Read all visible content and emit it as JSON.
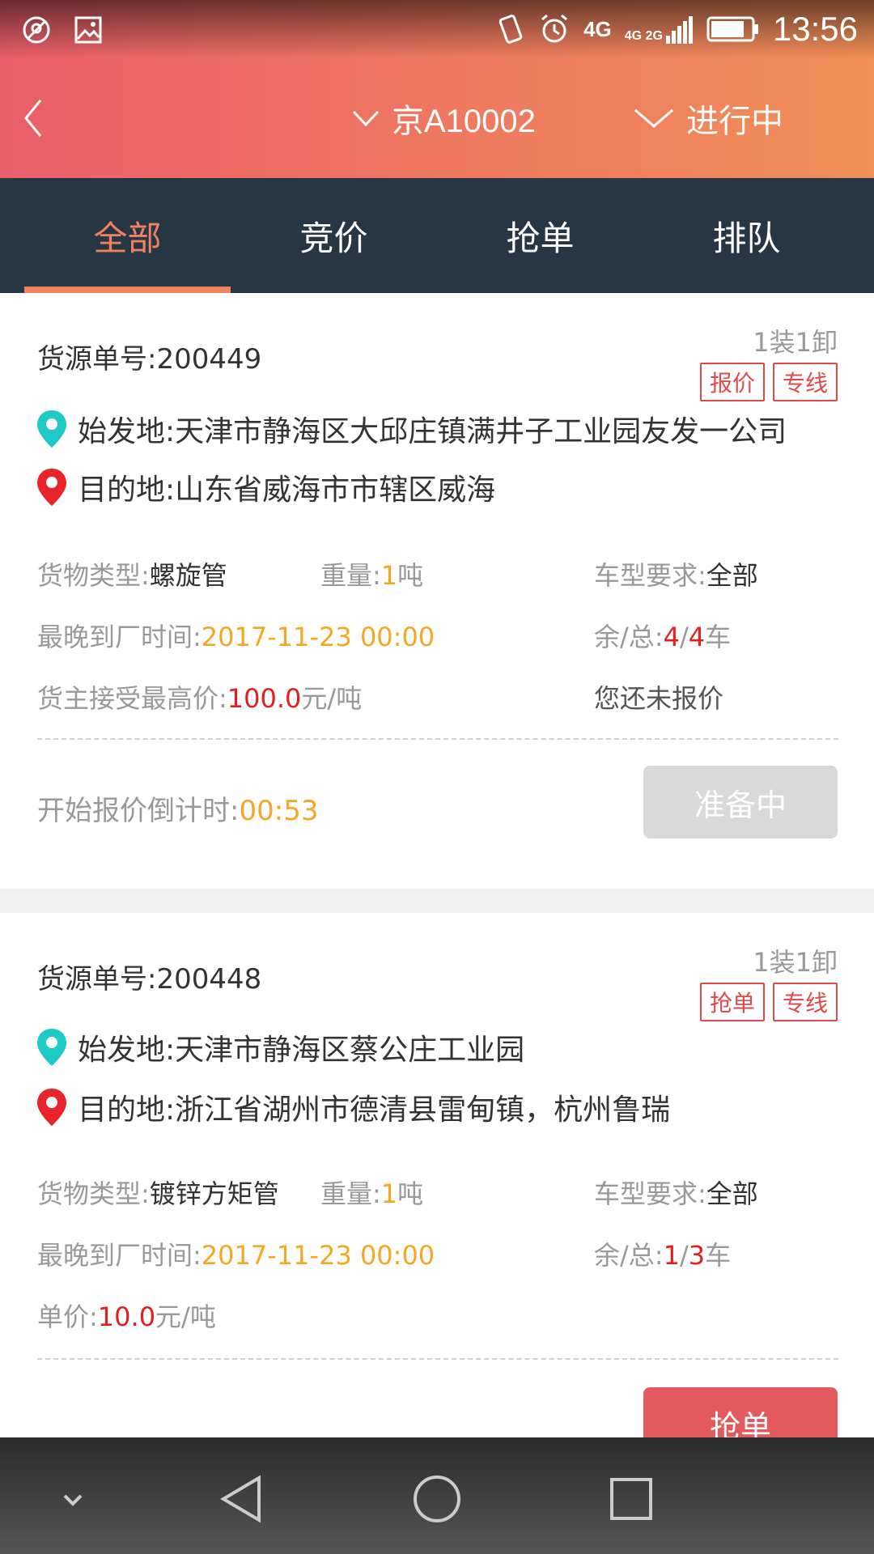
{
  "status_bar": {
    "time": "13:56",
    "network": "4G",
    "network_secondary": "4G 2G"
  },
  "app_bar": {
    "plate_selector": "京A10002",
    "status_selector": "进行中"
  },
  "tabs": [
    {
      "label": "全部",
      "active": true
    },
    {
      "label": "竞价",
      "active": false
    },
    {
      "label": "抢单",
      "active": false
    },
    {
      "label": "排队",
      "active": false
    }
  ],
  "cards": [
    {
      "order_label": "货源单号:",
      "order_no": "200449",
      "load_info": "1装1卸",
      "tags": [
        "报价",
        "专线"
      ],
      "origin_label": "始发地:",
      "origin": "天津市静海区大邱庄镇满井子工业园友发一公司",
      "dest_label": "目的地:",
      "dest": "山东省威海市市辖区威海",
      "cargo_type_label": "货物类型:",
      "cargo_type": "螺旋管",
      "weight_label": "重量:",
      "weight_value": "1",
      "weight_unit": "吨",
      "vehicle_label": "车型要求:",
      "vehicle": "全部",
      "deadline_label": "最晚到厂时间:",
      "deadline": "2017-11-23 00:00",
      "remain_label": "余/总:",
      "remain": "4",
      "slash": "/",
      "total": "4",
      "remain_unit": "车",
      "price_label": "货主接受最高价:",
      "price": "100.0",
      "price_unit": "元/吨",
      "quote_status": "您还未报价",
      "countdown_label": "开始报价倒计时:",
      "countdown": "00:53",
      "action_button": "准备中"
    },
    {
      "order_label": "货源单号:",
      "order_no": "200448",
      "load_info": "1装1卸",
      "tags": [
        "抢单",
        "专线"
      ],
      "origin_label": "始发地:",
      "origin": "天津市静海区蔡公庄工业园",
      "dest_label": "目的地:",
      "dest": "浙江省湖州市德清县雷甸镇，杭州鲁瑞",
      "cargo_type_label": "货物类型:",
      "cargo_type": "镀锌方矩管",
      "weight_label": "重量:",
      "weight_value": "1",
      "weight_unit": "吨",
      "vehicle_label": "车型要求:",
      "vehicle": "全部",
      "deadline_label": "最晚到厂时间:",
      "deadline": "2017-11-23 00:00",
      "remain_label": "余/总:",
      "remain": "1",
      "slash": "/",
      "total": "3",
      "remain_unit": "车",
      "price_label": "单价:",
      "price": "10.0",
      "price_unit": "元/吨",
      "action_button": "抢单"
    }
  ],
  "colors": {
    "header_start": "#ea5e6a",
    "header_end": "#f18f58",
    "tab_bar": "#263645",
    "accent": "#f0835d",
    "orange_text": "#f5a623",
    "red_text": "#e02020"
  }
}
